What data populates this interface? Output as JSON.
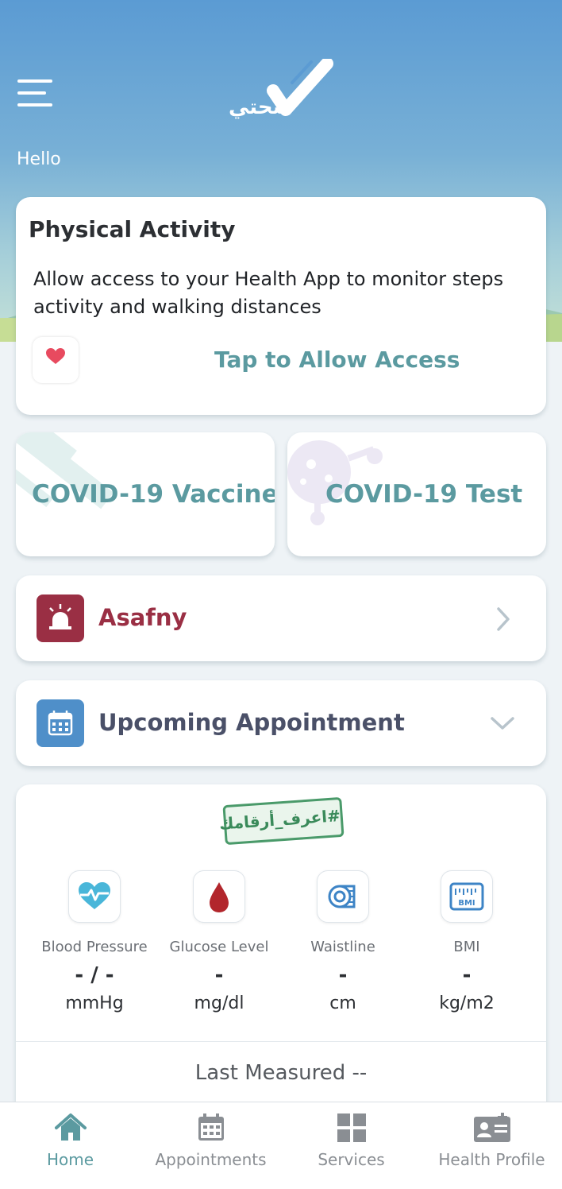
{
  "header": {
    "logo_text": "صحتي",
    "greeting": "Hello"
  },
  "physical_activity": {
    "title": "Physical Activity",
    "description": "Allow access to your Health App to monitor steps activity and walking distances",
    "action_label": "Tap to Allow Access"
  },
  "covid": {
    "vaccine_label": "COVID-19 Vaccine",
    "test_label": "COVID-19 Test"
  },
  "asafny": {
    "label": "Asafny"
  },
  "appointment": {
    "label": "Upcoming Appointment"
  },
  "numbers": {
    "stamp_text": "#اعرف_أرقامك",
    "metrics": [
      {
        "label": "Blood Pressure",
        "value": "- / -",
        "unit": "mmHg",
        "icon": "heart-pulse-icon"
      },
      {
        "label": "Glucose Level",
        "value": "-",
        "unit": "mg/dl",
        "icon": "blood-drop-icon"
      },
      {
        "label": "Waistline",
        "value": "-",
        "unit": "cm",
        "icon": "measuring-tape-icon"
      },
      {
        "label": "BMI",
        "value": "-",
        "unit": "kg/m2",
        "icon": "bmi-scale-icon"
      }
    ],
    "last_measured": "Last Measured --"
  },
  "tabs": [
    {
      "label": "Home",
      "icon": "home-icon",
      "active": true
    },
    {
      "label": "Appointments",
      "icon": "calendar-icon",
      "active": false
    },
    {
      "label": "Services",
      "icon": "grid-icon",
      "active": false
    },
    {
      "label": "Health Profile",
      "icon": "id-card-icon",
      "active": false
    }
  ],
  "colors": {
    "accent": "#5b9aa0",
    "asafny": "#9a2f44",
    "appointment_text": "#4a5068",
    "calendar_icon_bg": "#4f8fc9"
  }
}
